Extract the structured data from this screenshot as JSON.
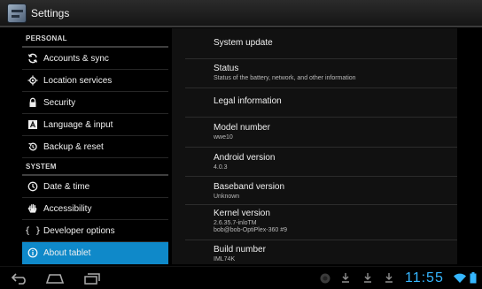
{
  "app": {
    "title": "Settings"
  },
  "sections": {
    "personal": "PERSONAL",
    "system": "SYSTEM"
  },
  "left_items": {
    "accounts": "Accounts & sync",
    "location": "Location services",
    "security": "Security",
    "language": "Language & input",
    "backup": "Backup & reset",
    "datetime": "Date & time",
    "accessibility": "Accessibility",
    "developer": "Developer options",
    "about": "About tablet"
  },
  "right_items": {
    "system_update": {
      "title": "System update"
    },
    "status": {
      "title": "Status",
      "sub": "Status of the battery, network, and other information"
    },
    "legal": {
      "title": "Legal information"
    },
    "model": {
      "title": "Model number",
      "value": "wwe10"
    },
    "android": {
      "title": "Android version",
      "value": "4.0.3"
    },
    "baseband": {
      "title": "Baseband version",
      "value": "Unknown"
    },
    "kernel": {
      "title": "Kernel version",
      "value1": "2.6.35.7-inloTM",
      "value2": "bob@bob-OptiPlex-360 #9"
    },
    "build": {
      "title": "Build number",
      "value": "IML74K"
    }
  },
  "status_bar": {
    "clock": "11:55"
  },
  "colors": {
    "selected": "#0f89c9",
    "clock": "#35b6ff"
  },
  "icons": {
    "accounts": "sync-icon",
    "location": "location-icon",
    "security": "lock-icon",
    "language": "keyboard-icon",
    "backup": "backup-icon",
    "datetime": "clock-icon",
    "accessibility": "hand-icon",
    "developer": "braces-icon",
    "about": "info-icon"
  }
}
